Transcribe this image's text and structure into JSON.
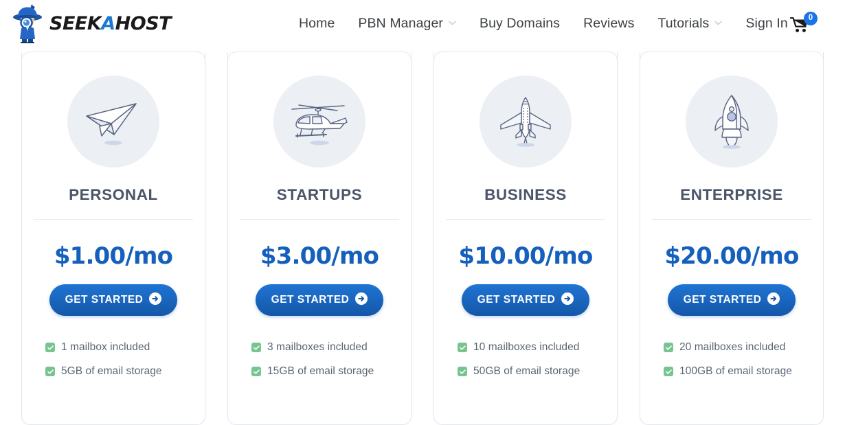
{
  "header": {
    "logo": {
      "icon_name": "seekahost-detective-logo",
      "text_part1": "SEEK",
      "text_accent": "A",
      "text_part2": "HOST"
    },
    "nav": [
      {
        "label": "Home",
        "has_dropdown": false
      },
      {
        "label": "PBN Manager",
        "has_dropdown": true
      },
      {
        "label": "Buy Domains",
        "has_dropdown": false
      },
      {
        "label": "Reviews",
        "has_dropdown": false
      },
      {
        "label": "Tutorials",
        "has_dropdown": true
      },
      {
        "label": "Sign In",
        "has_dropdown": false
      }
    ],
    "cart": {
      "icon_name": "shopping-cart-icon",
      "badge_count": "0",
      "badge_color": "#1a73e8"
    }
  },
  "colors": {
    "price_blue": "#1560bd",
    "button_blue": "#1f74d4",
    "title_slate": "#4a5568",
    "check_green": "#77c490",
    "icon_circle_bg": "#eceff4"
  },
  "plans": [
    {
      "icon_name": "paper-plane-icon",
      "title": "PERSONAL",
      "price": "$1.00/mo",
      "cta_label": "GET STARTED",
      "features": [
        "1 mailbox included",
        "5GB of email storage"
      ]
    },
    {
      "icon_name": "helicopter-icon",
      "title": "STARTUPS",
      "price": "$3.00/mo",
      "cta_label": "GET STARTED",
      "features": [
        "3 mailboxes included",
        "15GB of email storage"
      ]
    },
    {
      "icon_name": "airplane-icon",
      "title": "BUSINESS",
      "price": "$10.00/mo",
      "cta_label": "GET STARTED",
      "features": [
        "10 mailboxes included",
        "50GB of email storage"
      ]
    },
    {
      "icon_name": "rocket-icon",
      "title": "ENTERPRISE",
      "price": "$20.00/mo",
      "cta_label": "GET STARTED",
      "features": [
        "20 mailboxes included",
        "100GB of email storage"
      ]
    }
  ]
}
